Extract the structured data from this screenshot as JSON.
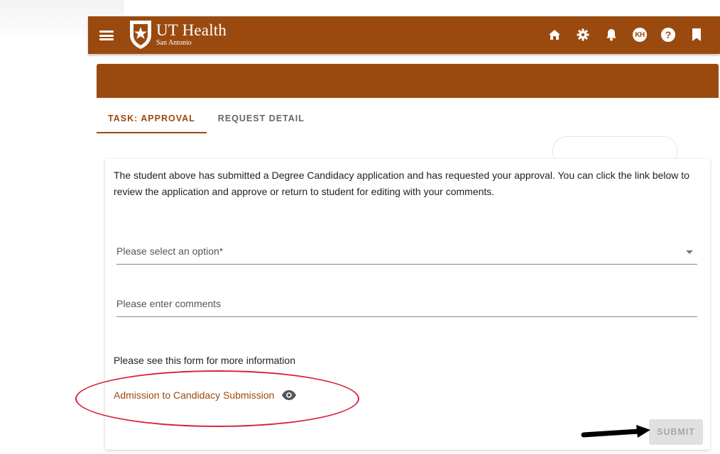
{
  "app": {
    "brand_name": "UT Health",
    "brand_sub": "San Antonio",
    "avatar_initials": "KH",
    "help_glyph": "?",
    "icons": [
      "menu-icon",
      "home-icon",
      "gear-icon",
      "bell-icon",
      "avatar-icon",
      "help-icon",
      "bookmark-icon"
    ],
    "colors": {
      "brand": "#9b4a0f",
      "annotation": "#d8203a"
    }
  },
  "tabs": [
    {
      "label": "TASK: APPROVAL",
      "active": true
    },
    {
      "label": "REQUEST DETAIL",
      "active": false
    }
  ],
  "card": {
    "description": "The student above has submitted a Degree Candidacy application and has requested your approval. You can click the link below to review the application and approve or return to student for editing with your comments.",
    "select_placeholder": "Please select an option*",
    "comments_placeholder": "Please enter comments",
    "info_text": "Please see this form for more information",
    "link_text": "Admission to Candidacy Submission",
    "submit_label": "SUBMIT"
  }
}
